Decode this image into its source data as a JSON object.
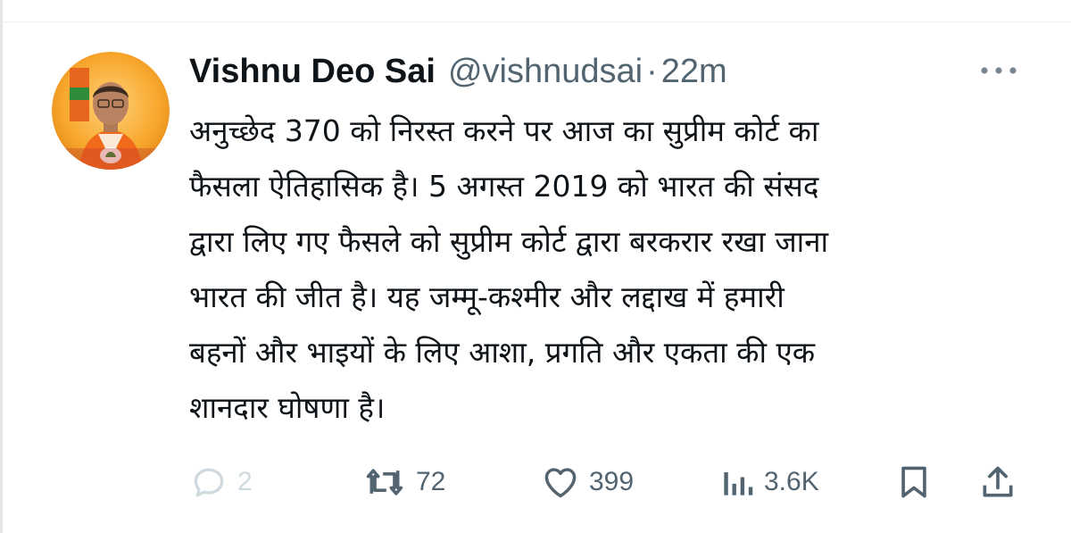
{
  "author": {
    "display_name": "Vishnu Deo Sai",
    "handle": "@vishnudsai",
    "separator": "·",
    "time": "22m"
  },
  "tweet": {
    "text": "अनुच्छेद 370 को निरस्त करने पर आज का सुप्रीम कोर्ट का\nफैसला ऐतिहासिक है। 5 अगस्त 2019 को भारत की संसद\nद्वारा लिए गए फैसले को सुप्रीम कोर्ट द्वारा बरकरार रखा जाना\nभारत की जीत है। यह जम्मू-कश्मीर और लद्दाख में हमारी\nबहनों और भाइयों के लिए आशा, प्रगति और एकता की एक\nशानदार घोषणा है।"
  },
  "actions": {
    "reply": {
      "icon": "reply-icon",
      "count": "2"
    },
    "retweet": {
      "icon": "retweet-icon",
      "count": "72"
    },
    "like": {
      "icon": "heart-icon",
      "count": "399"
    },
    "views": {
      "icon": "views-chart-icon",
      "count": "3.6K"
    },
    "bookmark": {
      "icon": "bookmark-icon"
    },
    "share": {
      "icon": "share-icon"
    }
  },
  "menu": {
    "icon": "more-dots-icon"
  },
  "colors": {
    "text_primary": "#0f1419",
    "text_secondary": "#536471",
    "disabled": "#cfd9de",
    "avatar_bg": "#f5a623",
    "party_saffron": "#f47c20"
  }
}
